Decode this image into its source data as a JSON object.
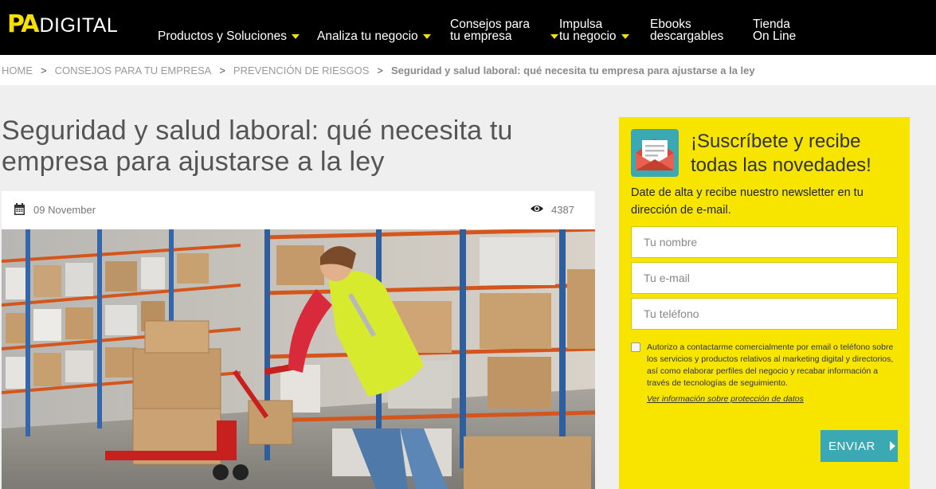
{
  "header": {
    "logo_mark": "PA",
    "logo_text": "DIGITAL",
    "nav": [
      {
        "line1": "Productos y Soluciones",
        "line2": ""
      },
      {
        "line1": "Analiza tu negocio",
        "line2": ""
      },
      {
        "line1": "Consejos para",
        "line2": "tu empresa"
      },
      {
        "line1": "Impulsa",
        "line2": "tu negocio"
      },
      {
        "line1": "Ebooks",
        "line2": "descargables"
      },
      {
        "line1": "Tienda",
        "line2": "On Line"
      }
    ]
  },
  "breadcrumb": {
    "items": [
      "HOME",
      "CONSEJOS PARA TU EMPRESA",
      "PREVENCIÓN DE RIESGOS"
    ],
    "current": "Seguridad y salud laboral: qué necesita tu empresa para ajustarse a la ley",
    "separator": ">"
  },
  "article": {
    "title": "Seguridad y salud laboral: qué necesita tu empresa para ajustarse a la ley",
    "date": "09 November",
    "views": "4387",
    "icons": {
      "date": "calendar-icon",
      "views": "eye-icon"
    }
  },
  "subscribe": {
    "title": "¡Suscríbete y recibe todas las novedades!",
    "description": "Date de alta y recibe nuestro newsletter en tu dirección de e-mail.",
    "name_placeholder": "Tu nombre",
    "email_placeholder": "Tu e-mail",
    "phone_placeholder": "Tu teléfono",
    "consent_text": "Autorizo a contactarme comercialmente por email o teléfono sobre los servicios y productos relativos al marketing digital y directorios, así como elaborar perfiles del negocio y recabar información a través de tecnologías de seguimiento.",
    "privacy_link": "Ver información sobre protección de datos",
    "button_label": "ENVIAR",
    "icon": "newsletter-envelope-icon"
  },
  "colors": {
    "accent_yellow": "#f5e000",
    "button_teal": "#3aa9b3",
    "header_black": "#000000"
  }
}
